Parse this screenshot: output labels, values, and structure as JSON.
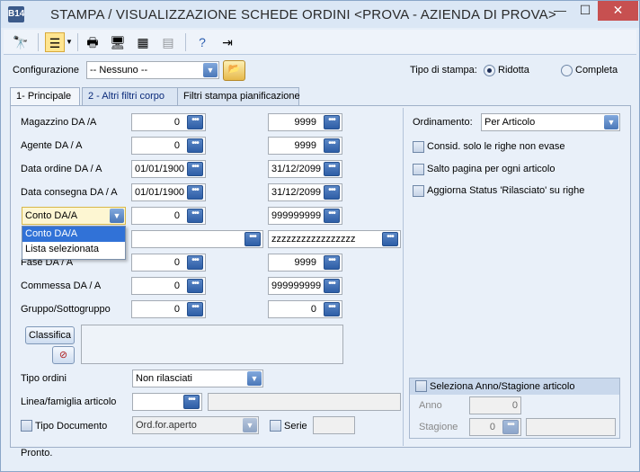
{
  "window": {
    "title": "STAMPA / VISUALIZZAZIONE SCHEDE ORDINI <PROVA - AZIENDA DI PROVA>",
    "icon_text": "B14",
    "min": "—",
    "max": "☐",
    "close": "✕"
  },
  "toolbar": {
    "icons": [
      "binoculars-icon",
      "list-select-icon",
      "printer-icon",
      "monitor-icon",
      "grid-icon",
      "disabled-print-icon",
      "help-icon",
      "exit-icon"
    ]
  },
  "config": {
    "label": "Configurazione",
    "value": "-- Nessuno --"
  },
  "print_type": {
    "label": "Tipo di stampa:",
    "option1": "Ridotta",
    "option2": "Completa",
    "selected": "Ridotta"
  },
  "tabs": [
    "1- Principale",
    "2 - Altri filtri corpo",
    "Filtri stampa pianificazione"
  ],
  "rows": [
    {
      "label": "Magazzino DA /A",
      "from": "0",
      "to": "9999"
    },
    {
      "label": "Agente DA / A",
      "from": "0",
      "to": "9999"
    },
    {
      "label": "Data ordine DA / A",
      "from": "01/01/1900",
      "to": "31/12/2099"
    },
    {
      "label": "Data consegna DA / A",
      "from": "01/01/1900",
      "to": "31/12/2099"
    },
    {
      "label": "Conto DA/A",
      "from": "0",
      "to": "999999999"
    },
    {
      "label": "",
      "from": "",
      "to": "zzzzzzzzzzzzzzzzz"
    },
    {
      "label": "Fase DA / A",
      "from": "0",
      "to": "9999"
    },
    {
      "label": "Commessa DA / A",
      "from": "0",
      "to": "999999999"
    },
    {
      "label": "Gruppo/Sottogruppo",
      "from": "0",
      "to": "0"
    }
  ],
  "conto_dropdown": {
    "options": [
      "Conto DA/A",
      "Lista selezionata"
    ],
    "selected": "Conto DA/A"
  },
  "classifica_button": "Classifica",
  "tipo_ordini": {
    "label": "Tipo ordini",
    "value": "Non rilasciati"
  },
  "linea": {
    "label": "Linea/famiglia articolo",
    "value": ""
  },
  "tipo_documento": {
    "label": "Tipo Documento",
    "value": "Ord.for.aperto",
    "serie_label": "Serie"
  },
  "right": {
    "ordinamento_label": "Ordinamento:",
    "ordinamento_value": "Per Articolo",
    "checks": [
      "Consid. solo le righe non evase",
      "Salto pagina per ogni articolo",
      "Aggiorna Status 'Rilasciato' su righe"
    ]
  },
  "anno_group": {
    "title": "Seleziona Anno/Stagione articolo",
    "anno_label": "Anno",
    "anno_value": "0",
    "stagione_label": "Stagione",
    "stagione_value": "0"
  },
  "status": "Pronto.",
  "dots": "•••"
}
